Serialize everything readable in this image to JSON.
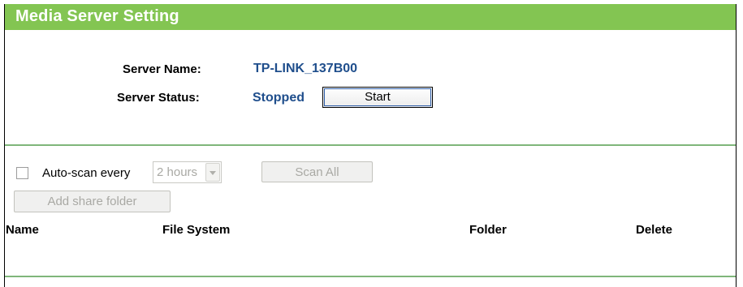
{
  "header": {
    "title": "Media Server Setting"
  },
  "server": {
    "name_label": "Server Name:",
    "name_value": "TP-LINK_137B00",
    "status_label": "Server Status:",
    "status_value": "Stopped",
    "start_label": "Start"
  },
  "scan": {
    "auto_scan_checked": false,
    "auto_scan_label": "Auto-scan every",
    "interval_value": "2 hours",
    "scan_all_label": "Scan All",
    "add_folder_label": "Add share folder"
  },
  "table": {
    "columns": [
      "Name",
      "File System",
      "Folder",
      "Delete"
    ],
    "rows": []
  },
  "colors": {
    "header_bg": "#83c552",
    "value_text": "#1f4e8c",
    "divider": "#7fb67a"
  }
}
